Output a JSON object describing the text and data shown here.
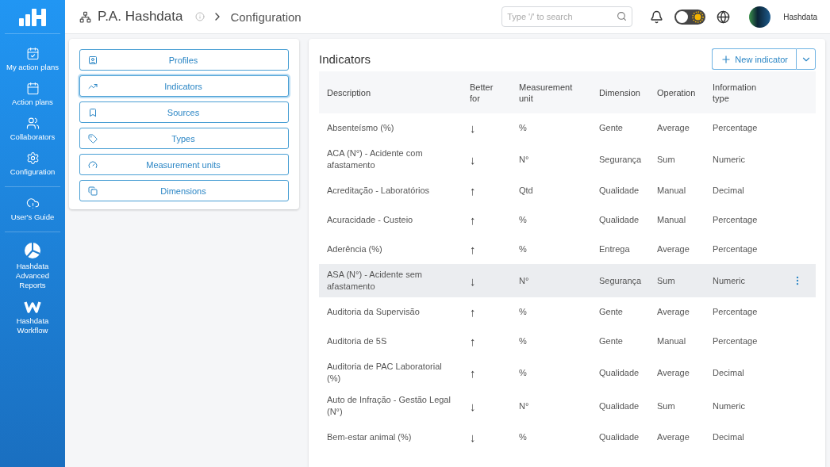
{
  "sidebar": {
    "items": [
      {
        "label": "My action plans"
      },
      {
        "label": "Action plans"
      },
      {
        "label": "Collaborators"
      },
      {
        "label": "Configuration"
      },
      {
        "label": "User's Guide"
      },
      {
        "label": "Hashdata Advanced Reports"
      },
      {
        "label": "Hashdata Workflow"
      }
    ]
  },
  "header": {
    "title": "P.A. Hashdata",
    "breadcrumb": "Configuration",
    "search": {
      "placeholder": "Type '/' to search"
    },
    "theme_toggle": {
      "on": false
    },
    "user": "Hashdata"
  },
  "config_menu": [
    {
      "label": "Profiles",
      "selected": false
    },
    {
      "label": "Indicators",
      "selected": true
    },
    {
      "label": "Sources",
      "selected": false
    },
    {
      "label": "Types",
      "selected": false
    },
    {
      "label": "Measurement units",
      "selected": false
    },
    {
      "label": "Dimensions",
      "selected": false
    }
  ],
  "indicators": {
    "title": "Indicators",
    "new_button": "New indicator",
    "columns": [
      "Description",
      "Better for",
      "Measurement unit",
      "Dimension",
      "Operation",
      "Information type"
    ],
    "rows": [
      {
        "description": "Absenteísmo (%)",
        "better": "↓",
        "unit": "%",
        "dimension": "Gente",
        "operation": "Average",
        "type": "Percentage",
        "selected": false
      },
      {
        "description": "ACA (N°) - Acidente com afastamento",
        "better": "↓",
        "unit": "N°",
        "dimension": "Segurança",
        "operation": "Sum",
        "type": "Numeric",
        "selected": false
      },
      {
        "description": "Acreditação - Laboratórios",
        "better": "↑",
        "unit": "Qtd",
        "dimension": "Qualidade",
        "operation": "Manual",
        "type": "Decimal",
        "selected": false
      },
      {
        "description": "Acuracidade - Custeio",
        "better": "↑",
        "unit": "%",
        "dimension": "Qualidade",
        "operation": "Manual",
        "type": "Percentage",
        "selected": false
      },
      {
        "description": "Aderência (%)",
        "better": "↑",
        "unit": "%",
        "dimension": "Entrega",
        "operation": "Average",
        "type": "Percentage",
        "selected": false
      },
      {
        "description": "ASA (N°) - Acidente sem afastamento",
        "better": "↓",
        "unit": "N°",
        "dimension": "Segurança",
        "operation": "Sum",
        "type": "Numeric",
        "selected": true
      },
      {
        "description": "Auditoria da Supervisão",
        "better": "↑",
        "unit": "%",
        "dimension": "Gente",
        "operation": "Average",
        "type": "Percentage",
        "selected": false
      },
      {
        "description": "Auditoria de 5S",
        "better": "↑",
        "unit": "%",
        "dimension": "Gente",
        "operation": "Manual",
        "type": "Percentage",
        "selected": false
      },
      {
        "description": "Auditoria de PAC Laboratorial (%)",
        "better": "↑",
        "unit": "%",
        "dimension": "Qualidade",
        "operation": "Average",
        "type": "Decimal",
        "selected": false
      },
      {
        "description": "Auto de Infração - Gestão Legal (N°)",
        "better": "↓",
        "unit": "N°",
        "dimension": "Qualidade",
        "operation": "Sum",
        "type": "Numeric",
        "selected": false
      },
      {
        "description": "Bem-estar animal (%)",
        "better": "↓",
        "unit": "%",
        "dimension": "Qualidade",
        "operation": "Average",
        "type": "Decimal",
        "selected": false
      }
    ]
  }
}
